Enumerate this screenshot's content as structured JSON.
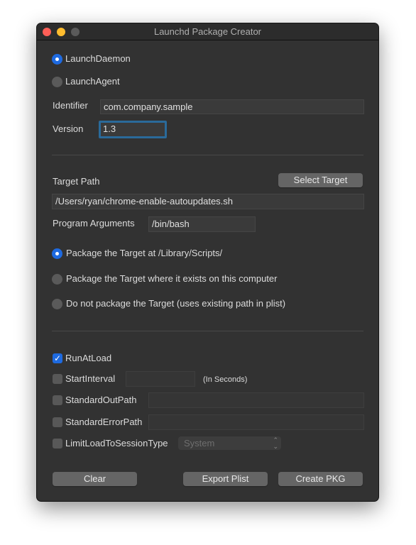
{
  "window": {
    "title": "Launchd Package Creator"
  },
  "type_options": [
    {
      "label": "LaunchDaemon",
      "selected": true
    },
    {
      "label": "LaunchAgent",
      "selected": false
    }
  ],
  "identifier": {
    "label": "Identifier",
    "value": "com.company.sample"
  },
  "version": {
    "label": "Version",
    "value": "1.3"
  },
  "target": {
    "label": "Target Path",
    "select_button": "Select Target",
    "value": "/Users/ryan/chrome-enable-autoupdates.sh"
  },
  "program_arguments": {
    "label": "Program Arguments",
    "value": "/bin/bash"
  },
  "package_options": [
    {
      "label": "Package the Target at /Library/Scripts/",
      "selected": true
    },
    {
      "label": "Package the Target where it exists on this computer",
      "selected": false
    },
    {
      "label": "Do not package the Target (uses existing path in plist)",
      "selected": false
    }
  ],
  "options": {
    "run_at_load": {
      "label": "RunAtLoad",
      "checked": true
    },
    "start_interval": {
      "label": "StartInterval",
      "checked": false,
      "value": "",
      "unit": "(In Seconds)"
    },
    "stdout": {
      "label": "StandardOutPath",
      "checked": false,
      "value": ""
    },
    "stderr": {
      "label": "StandardErrorPath",
      "checked": false,
      "value": ""
    },
    "session_type": {
      "label": "LimitLoadToSessionType",
      "checked": false,
      "selected": "System"
    }
  },
  "buttons": {
    "clear": "Clear",
    "export": "Export Plist",
    "create": "Create PKG"
  },
  "colors": {
    "accent": "#1e6ae0",
    "window_bg": "#323232",
    "focus_ring": "#2a6a9a"
  }
}
